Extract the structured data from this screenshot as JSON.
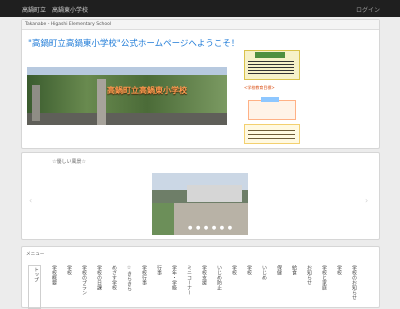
{
  "topbar": {
    "title": "高鍋町立　高鍋東小学校",
    "login": "ログイン"
  },
  "header": {
    "breadcrumb": "Takanabe - Higashi Elementary School"
  },
  "main": {
    "welcome": "\"高鍋町立高鍋東小学校\"公式ホームページへようこそ！",
    "hero_label": "高鍋町立高鍋東小学校",
    "red_tag": "<学校教育目標>"
  },
  "gallery": {
    "title": "☆優しい風景☆",
    "dots": "● ● ● ● ● ●"
  },
  "menu": {
    "label": "メニュー",
    "items": [
      "トップ",
      "学校概要",
      "学校",
      "学校のプラン",
      "学校の日課",
      "めざす学校",
      "☆きらきら",
      "学校行事",
      "行事",
      "学年・学級",
      "ミニコーナー",
      "学校支援",
      "いじめ防止",
      "学校",
      "学校",
      "いじめ",
      "保健",
      "給食",
      "お知らせ",
      "学校と家庭",
      "学校",
      "学校のお知らせ"
    ]
  }
}
